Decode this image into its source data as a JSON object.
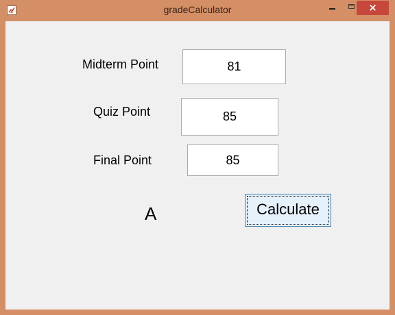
{
  "window": {
    "title": "gradeCalculator",
    "icon": "matlab-figure-icon",
    "controls": {
      "minimize": "minimize-icon",
      "maximize": "maximize-icon",
      "close": "×"
    }
  },
  "form": {
    "midterm": {
      "label": "Midterm Point",
      "value": "81"
    },
    "quiz": {
      "label": "Quiz Point",
      "value": "85"
    },
    "final": {
      "label": "Final Point",
      "value": "85"
    }
  },
  "result": {
    "grade": "A"
  },
  "actions": {
    "calculate_label": "Calculate"
  },
  "colors": {
    "frame": "#d48f66",
    "client": "#f0f0f0",
    "close_button": "#c7473c",
    "button_face": "#e5f1fb",
    "button_border": "#3c7fb1"
  }
}
